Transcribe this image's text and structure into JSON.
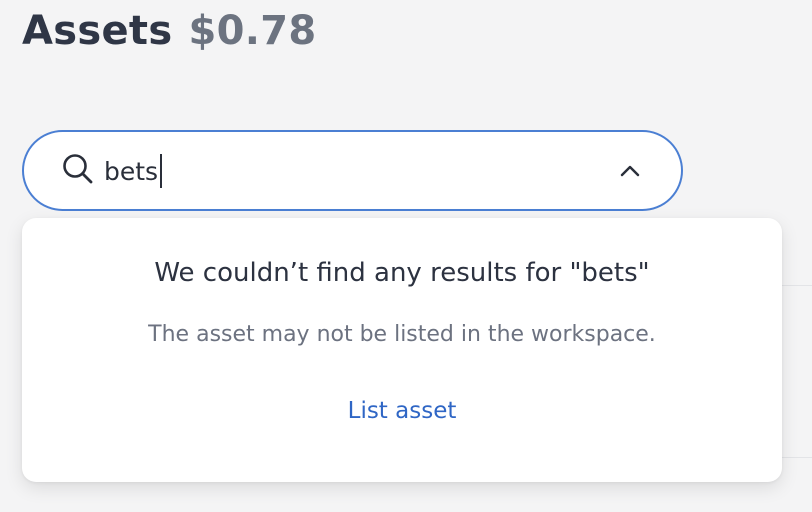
{
  "header": {
    "title": "Assets",
    "balance": "$0.78"
  },
  "search": {
    "value": "bets",
    "icon": "search-icon",
    "toggle_icon": "chevron-up-icon"
  },
  "results": {
    "empty_title": "We couldn’t find any results for \"bets\"",
    "empty_subtitle": "The asset may not be listed in the workspace.",
    "action_label": "List asset"
  },
  "colors": {
    "accent": "#2f66c5",
    "focus_border": "#4b7fd3",
    "title": "#2f3646",
    "muted": "#6c7380"
  }
}
